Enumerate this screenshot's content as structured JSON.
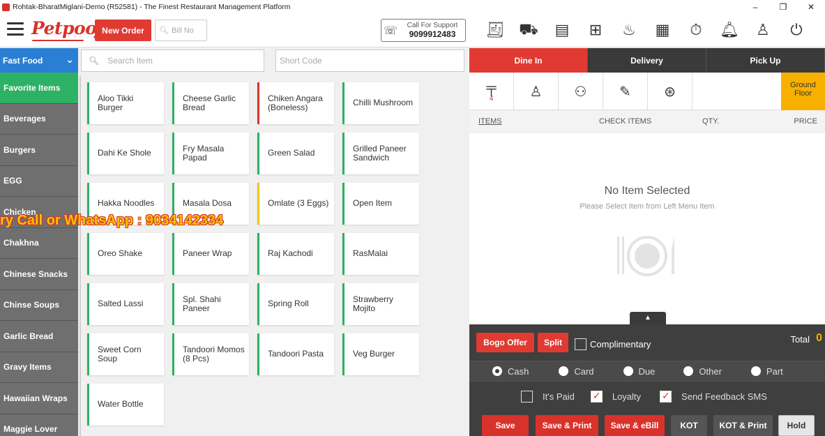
{
  "window": {
    "title": "Rohtak-BharatMiglani-Demo (R52581) - The Finest Restaurant Management Platform",
    "controls": [
      "–",
      "❐",
      "✕"
    ]
  },
  "header": {
    "logo": "Petpooja",
    "new_order_label": "New Order",
    "bill_placeholder": "Bill No",
    "support_label": "Call For Support",
    "support_phone": "9099912483",
    "icons": [
      "receipt-icon",
      "delivery-icon",
      "kot-icon",
      "grid-icon",
      "chef-icon",
      "orders-icon",
      "timer-icon",
      "bell-icon",
      "user-icon",
      "power-icon"
    ]
  },
  "categories": {
    "selected": "Fast Food",
    "items": [
      "Favorite Items",
      "Beverages",
      "Burgers",
      "EGG",
      "Chicken",
      "Chakhna",
      "Chinese Snacks",
      "Chinse Soups",
      "Garlic Bread",
      "Gravy Items",
      "Hawaiian Wraps",
      "Maggie Lover"
    ]
  },
  "search": {
    "placeholder": "Search Item",
    "shortcode_placeholder": "Short Code"
  },
  "menu_items": [
    [
      "Aloo Tikki Burger",
      "Cheese Garlic Bread",
      "Chiken Angara (Boneless)",
      "Chilli Mushroom"
    ],
    [
      "Dahi Ke Shole",
      "Fry Masala Papad",
      "Green Salad",
      "Grilled Paneer Sandwich"
    ],
    [
      "Hakka Noodles",
      "Masala Dosa",
      "Omlate (3 Eggs)",
      "Open Item"
    ],
    [
      "Oreo Shake",
      "Paneer Wrap",
      "Raj Kachodi",
      "RasMalai"
    ],
    [
      "Salted Lassi",
      "Spl. Shahi Paneer",
      "Spring Roll",
      "Strawberry Mojito"
    ],
    [
      "Sweet Corn Soup",
      "Tandoori Momos (8 Pcs)",
      "Tandoori Pasta",
      "Veg Burger"
    ],
    [
      "Water Bottle"
    ]
  ],
  "watermark": "ry Call or WhatsApp : 9034142334",
  "order": {
    "tabs": [
      "Dine In",
      "Delivery",
      "Pick Up"
    ],
    "table_count": "4",
    "area_button": "Ground Floor",
    "columns": [
      "ITEMS",
      "CHECK ITEMS",
      "QTY.",
      "PRICE"
    ],
    "empty_title": "No Item Selected",
    "empty_sub": "Please Select Item from Left Menu Item",
    "bogo_label": "Bogo Offer",
    "split_label": "Split",
    "complimentary_label": "Complimentary",
    "total_label": "Total",
    "total_value": "0",
    "payment_methods": [
      "Cash",
      "Card",
      "Due",
      "Other",
      "Part"
    ],
    "selected_payment": "Cash",
    "its_paid_label": "It's Paid",
    "loyalty_label": "Loyalty",
    "feedback_label": "Send Feedback SMS",
    "actions": [
      "Save",
      "Save & Print",
      "Save & eBill",
      "KOT",
      "KOT & Print",
      "Hold"
    ]
  }
}
